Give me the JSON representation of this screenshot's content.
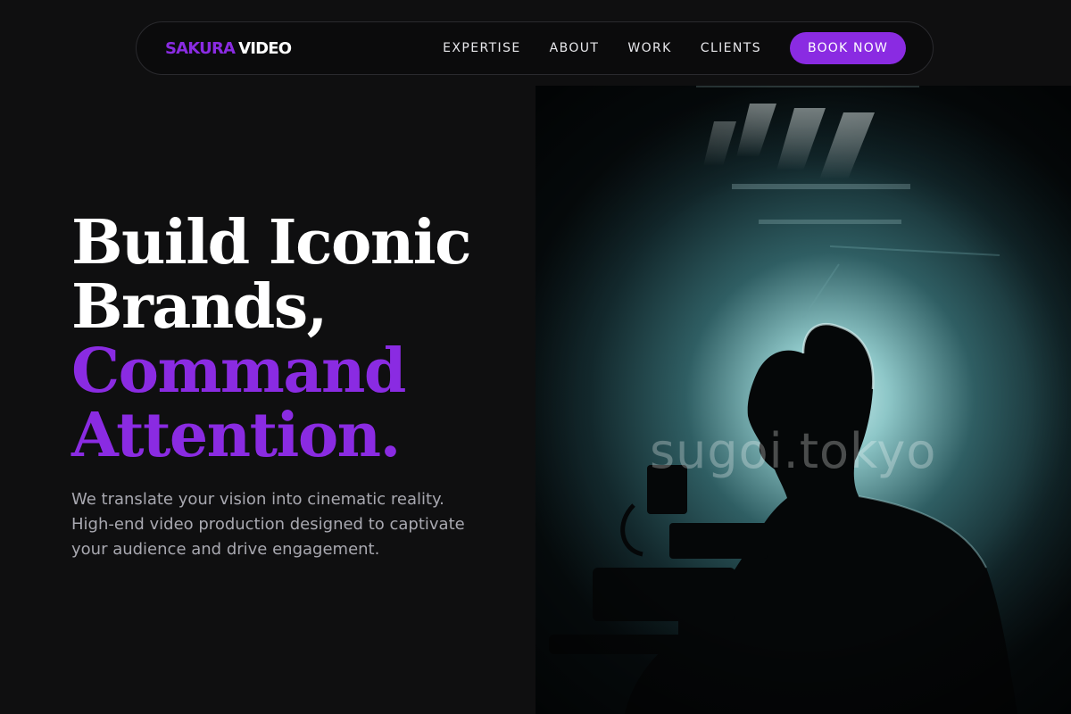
{
  "brand": {
    "part1": "SAKURA",
    "part2": "VIDEO"
  },
  "nav": {
    "links": [
      "EXPERTISE",
      "ABOUT",
      "WORK",
      "CLIENTS"
    ],
    "cta": "BOOK NOW"
  },
  "hero": {
    "headline": [
      "Build Iconic",
      "Brands,",
      "Command",
      "Attention."
    ],
    "subcopy": "We translate your vision into cinematic reality. High-end video production designed to captivate your audience and drive engagement.",
    "image_watermark": "sugoi.tokyo"
  },
  "colors": {
    "accent": "#8a2be2",
    "background": "#0f0f10"
  },
  "icons": {
    "hero_image": "videographer-silhouette-photo"
  }
}
